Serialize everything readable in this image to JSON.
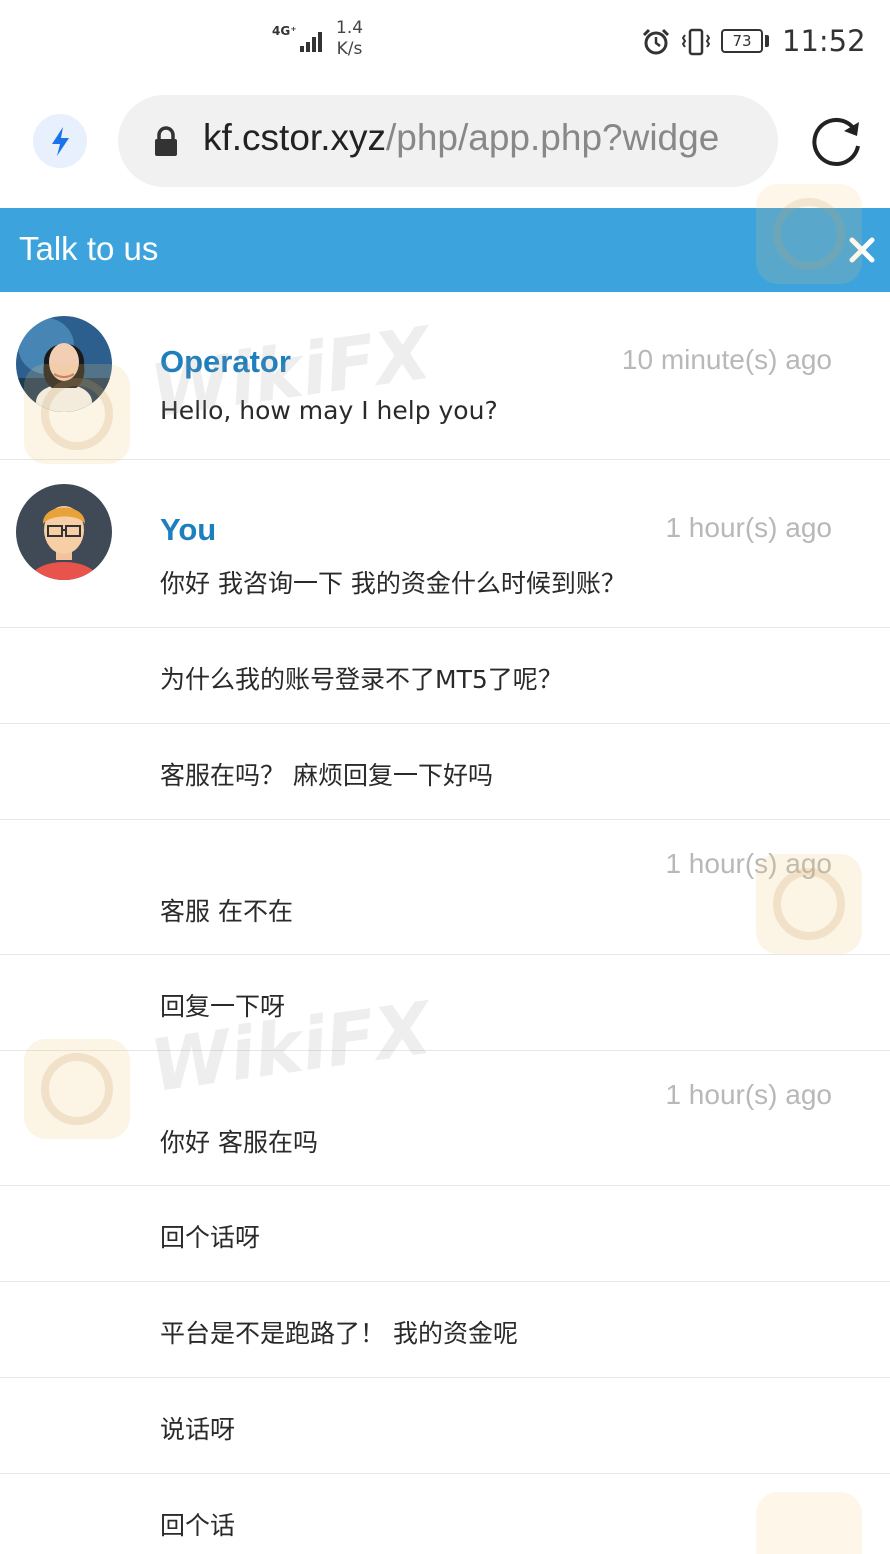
{
  "status_bar": {
    "network": "4G⁺",
    "speed_value": "1.4",
    "speed_unit": "K/s",
    "battery": "73",
    "time": "11:52"
  },
  "browser": {
    "url_host": "kf.cstor.xyz",
    "url_path": "/php/app.php?widge"
  },
  "chat": {
    "title": "Talk to us",
    "messages": [
      {
        "name": "Operator",
        "time": "10 minute(s) ago",
        "text": "Hello, how may I help you?"
      },
      {
        "name": "You",
        "time": "1 hour(s) ago",
        "text": "你好 我咨询一下 我的资金什么时候到账？"
      },
      {
        "text": "为什么我的账号登录不了MT5了呢？"
      },
      {
        "text": "客服在吗？ 麻烦回复一下好吗"
      },
      {
        "time": "1 hour(s) ago",
        "text": "客服 在不在"
      },
      {
        "text": "回复一下呀"
      },
      {
        "time": "1 hour(s) ago",
        "text": "你好 客服在吗"
      },
      {
        "text": "回个话呀"
      },
      {
        "text": "平台是不是跑路了！ 我的资金呢"
      },
      {
        "text": "说话呀"
      },
      {
        "text": "回个话"
      }
    ]
  },
  "watermark": "WikiFX",
  "colors": {
    "header": "#3ca3dc",
    "name": "#1e7fbf",
    "timestamp": "#b8b8b8"
  }
}
